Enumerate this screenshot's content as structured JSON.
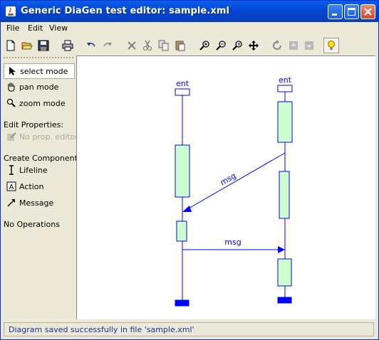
{
  "window": {
    "title": "Generic DiaGen test editor: sample.xml",
    "title_color": "#ffffff",
    "titlebar_color": "#0a5ee8"
  },
  "menu": [
    "File",
    "Edit",
    "View"
  ],
  "toolbar": {
    "icons": [
      "new-icon",
      "open-icon",
      "save-icon",
      "print-icon",
      "undo-icon",
      "redo-icon",
      "delete-icon",
      "cut-icon",
      "copy-icon",
      "paste-icon",
      "zoom-in-icon",
      "zoom-out-icon",
      "zoom-fit-icon",
      "move-icon",
      "refresh-icon",
      "bring-front-icon",
      "send-back-icon",
      "hint-bulb-icon"
    ]
  },
  "sidebar": {
    "modes": [
      {
        "label": "select mode",
        "icon": "arrow-cursor-icon",
        "selected": true
      },
      {
        "label": "pan mode",
        "icon": "hand-icon",
        "selected": false
      },
      {
        "label": "zoom mode",
        "icon": "magnifier-icon",
        "selected": false
      }
    ],
    "edit_properties_heading": "Edit Properties:",
    "no_prop_editor": "No prop. editor",
    "create_components_heading": "Create Components:",
    "components": [
      {
        "label": "Lifeline",
        "icon": "lifeline-icon"
      },
      {
        "label": "Action",
        "icon": "action-icon"
      },
      {
        "label": "Message",
        "icon": "message-arrow-icon"
      }
    ],
    "no_operations": "No Operations"
  },
  "diagram": {
    "stroke_color": "#0000ff",
    "activation_fill": "#ccffcc",
    "lifelines": [
      {
        "label": "ent"
      },
      {
        "label": "ent"
      }
    ],
    "messages": [
      {
        "label": "msg",
        "direction": "right-to-left"
      },
      {
        "label": "msg",
        "direction": "left-to-right"
      }
    ]
  },
  "status": {
    "text": "Diagram saved successfully in file 'sample.xml'",
    "color": "#1a2fa0"
  }
}
